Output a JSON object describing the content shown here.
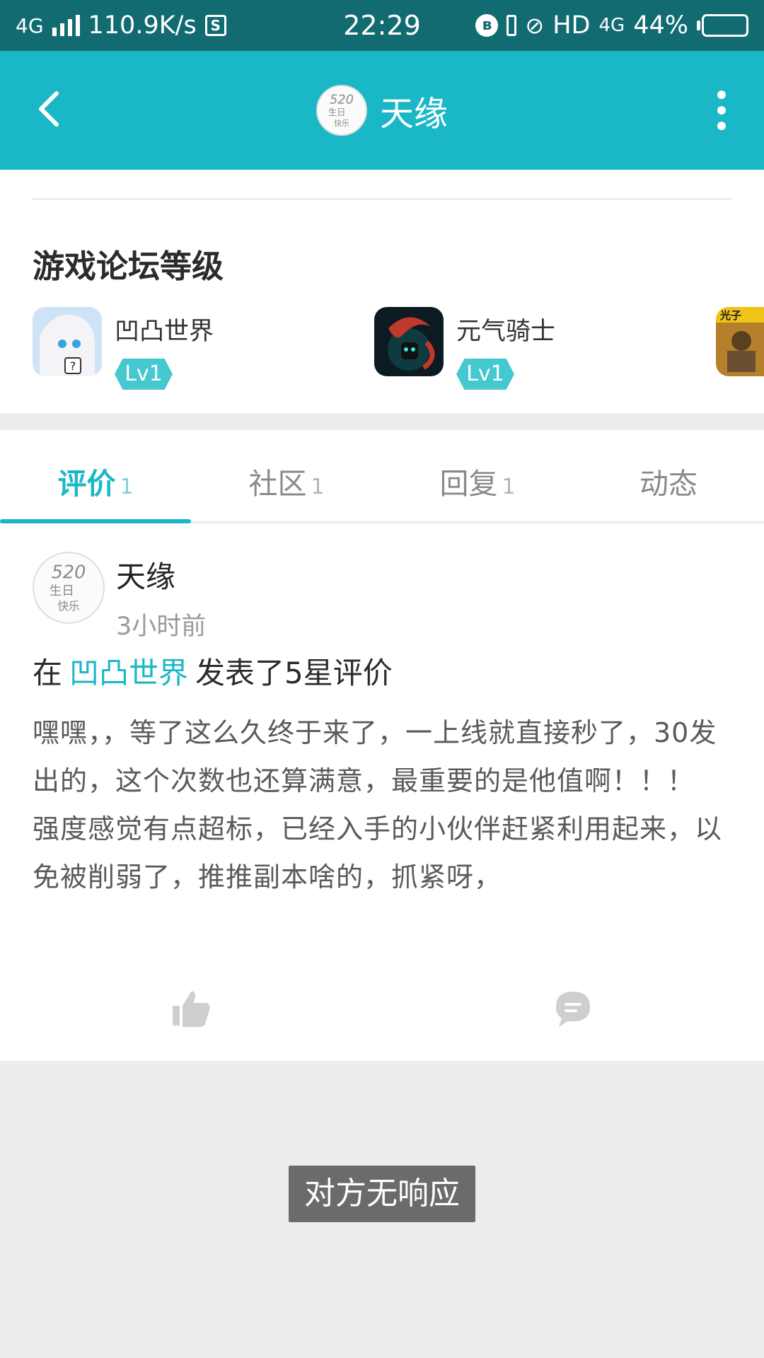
{
  "status_bar": {
    "network": "4G",
    "speed": "110.9K/s",
    "time": "22:29",
    "hd": "HD",
    "net_right": "4G",
    "battery": "44%",
    "battery_level": 0.44
  },
  "header": {
    "title": "天缘"
  },
  "levels": {
    "title": "游戏论坛等级",
    "games": [
      {
        "name": "凹凸世界",
        "level": "Lv1"
      },
      {
        "name": "元气骑士",
        "level": "Lv1"
      }
    ],
    "partial_game_icon_text": "光子"
  },
  "tabs": [
    {
      "label": "评价",
      "count": "1",
      "active": true
    },
    {
      "label": "社区",
      "count": "1",
      "active": false
    },
    {
      "label": "回复",
      "count": "1",
      "active": false
    },
    {
      "label": "动态",
      "count": "",
      "active": false
    }
  ],
  "review": {
    "user_name": "天缘",
    "time_ago": "3小时前",
    "prefix": "在",
    "game_link": "凹凸世界",
    "suffix": "发表了5星评价",
    "body": "嘿嘿，，等了这么久终于来了，一上线就直接秒了，30发出的，这个次数也还算满意，最重要的是他值啊！！！ 强度感觉有点超标，已经入手的小伙伴赶紧利用起来，以免被削弱了，推推副本啥的，抓紧呀，"
  },
  "avatar_text": {
    "line1": "520",
    "line2": "生日",
    "line3": "快乐"
  },
  "toast": {
    "text": "对方无响应"
  },
  "colors": {
    "accent": "#1ab8c6",
    "status_bar": "#136b72",
    "toast_bg": "#6b6b6b"
  }
}
